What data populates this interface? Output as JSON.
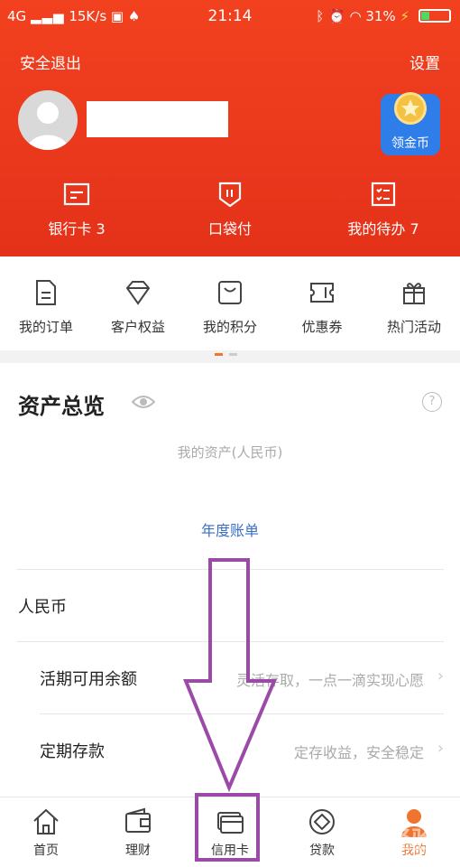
{
  "status_bar": {
    "network": "4G",
    "speed": "15K/s",
    "time": "21:14",
    "battery": "31%",
    "battery_level": 0.31
  },
  "header": {
    "logout": "安全退出",
    "settings": "设置",
    "coin_label": "领金币",
    "quick_actions": [
      {
        "label": "银行卡 3",
        "icon": "bank-card-icon"
      },
      {
        "label": "口袋付",
        "icon": "pocket-pay-icon"
      },
      {
        "label": "我的待办 7",
        "icon": "todo-icon"
      }
    ]
  },
  "shortcuts": [
    {
      "label": "我的订单",
      "icon": "order-icon"
    },
    {
      "label": "客户权益",
      "icon": "diamond-icon"
    },
    {
      "label": "我的积分",
      "icon": "points-icon"
    },
    {
      "label": "优惠券",
      "icon": "coupon-icon"
    },
    {
      "label": "热门活动",
      "icon": "gift-icon"
    }
  ],
  "assets": {
    "title": "资产总览",
    "help": "?",
    "subtitle": "我的资产(人民币)",
    "annual_bill": "年度账单",
    "currency": "人民币",
    "rows": [
      {
        "label": "活期可用余额",
        "desc": "灵活存取，一点一滴实现心愿"
      },
      {
        "label": "定期存款",
        "desc": "定存收益，安全稳定"
      }
    ]
  },
  "tabbar": [
    {
      "label": "首页",
      "icon": "home-icon"
    },
    {
      "label": "理财",
      "icon": "wallet-icon"
    },
    {
      "label": "信用卡",
      "icon": "credit-card-icon"
    },
    {
      "label": "贷款",
      "icon": "loan-icon"
    },
    {
      "label": "我的",
      "icon": "profile-icon"
    }
  ],
  "colors": {
    "brand_red": "#e4321a",
    "active_tab": "#f0742d",
    "link_blue": "#3a6fc4",
    "annotation_purple": "#9b4aa8"
  },
  "watermark": "经验"
}
